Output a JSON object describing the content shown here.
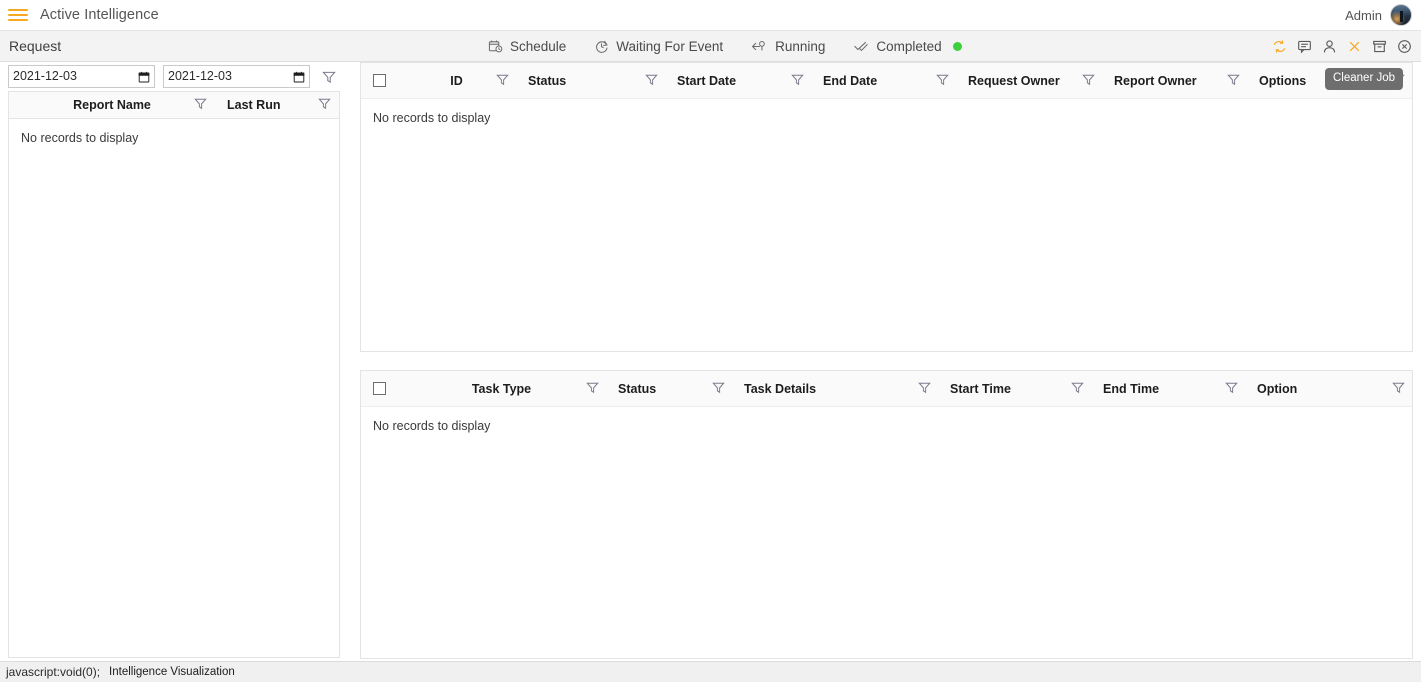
{
  "topbar": {
    "menu_icon": "hamburger-icon",
    "app_title": "Active Intelligence",
    "user_label": "Admin",
    "avatar_icon": "user-avatar"
  },
  "request_bar": {
    "title": "Request",
    "status_tabs": [
      {
        "label": "Schedule",
        "icon": "calendar-clock-icon",
        "dot": false
      },
      {
        "label": "Waiting For Event",
        "icon": "clock-icon",
        "dot": false
      },
      {
        "label": "Running",
        "icon": "running-arrow-icon",
        "dot": false
      },
      {
        "label": "Completed",
        "icon": "double-check-icon",
        "dot": true
      }
    ],
    "dot_color": "#3ecf3e",
    "icons": [
      {
        "name": "refresh-icon",
        "color": "#f7a823"
      },
      {
        "name": "comment-icon",
        "color": "#5a5a5a"
      },
      {
        "name": "user-icon",
        "color": "#5a5a5a"
      },
      {
        "name": "close-icon",
        "color": "#f7a823"
      },
      {
        "name": "archive-icon",
        "color": "#5a5a5a"
      },
      {
        "name": "circle-close-icon",
        "color": "#5a5a5a"
      }
    ]
  },
  "left_panel": {
    "date_from": {
      "value": "2021-12-03",
      "placeholder": "yyyy-mm-dd"
    },
    "date_to": {
      "value": "2021-12-03",
      "placeholder": "yyyy-mm-dd"
    },
    "filter_icon": "filter-funnel-icon",
    "table": {
      "columns": [
        "Report Name",
        "Last Run"
      ],
      "empty_message": "No records to display"
    }
  },
  "request_grid": {
    "columns": [
      "ID",
      "Status",
      "Start Date",
      "End Date",
      "Request Owner",
      "Report Owner",
      "Options"
    ],
    "empty_message": "No records to display",
    "select_all_checkbox": false
  },
  "task_grid": {
    "columns": [
      "Task Type",
      "Status",
      "Task Details",
      "Start Time",
      "End Time",
      "Option"
    ],
    "empty_message": "No records to display",
    "select_all_checkbox": false
  },
  "tooltip": {
    "text": "Cleaner Job"
  },
  "statusbar": {
    "link": "javascript:void(0);",
    "text": "Intelligence Visualization"
  },
  "theme": {
    "accent": "#f7a823",
    "header_bg": "#fafafa",
    "bar_bg": "#f3f3f3",
    "border": "#e4e4e4"
  }
}
